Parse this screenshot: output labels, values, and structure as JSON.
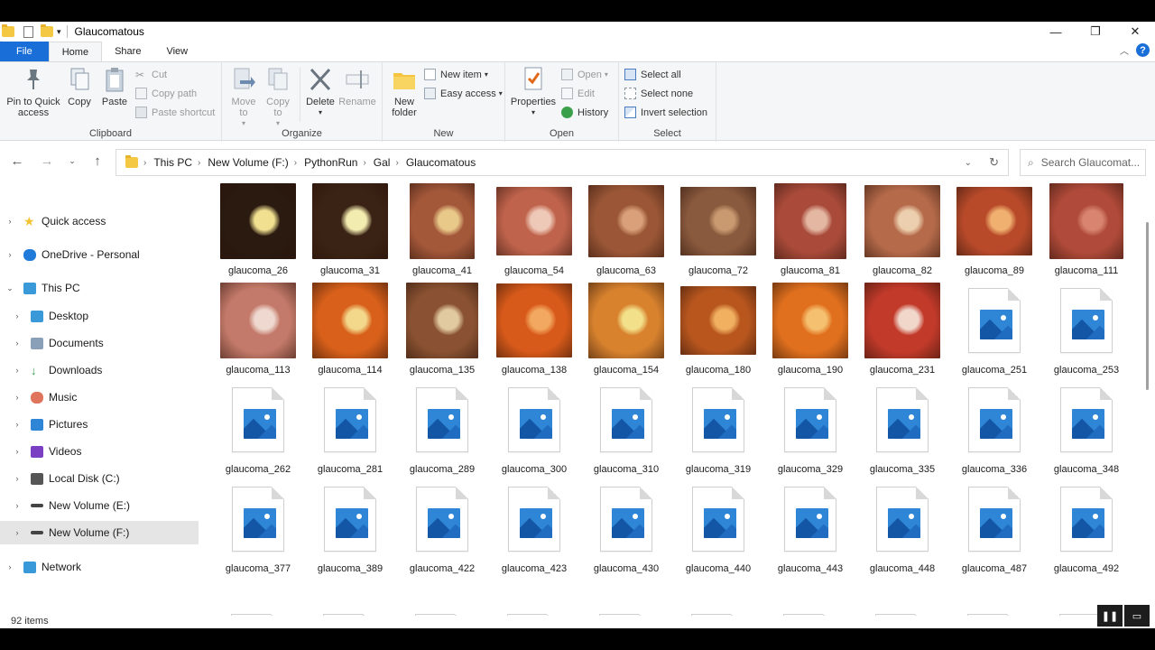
{
  "window": {
    "title": "Glaucomatous",
    "controls": [
      "—",
      "❐",
      "✕"
    ]
  },
  "ribbon_tabs": [
    "File",
    "Home",
    "Share",
    "View"
  ],
  "ribbon": {
    "clipboard": {
      "label": "Clipboard",
      "pin": "Pin to Quick access",
      "copy": "Copy",
      "paste": "Paste",
      "cut": "Cut",
      "copy_path": "Copy path",
      "paste_shortcut": "Paste shortcut"
    },
    "organize": {
      "label": "Organize",
      "move_to": "Move to",
      "copy_to": "Copy to",
      "delete": "Delete",
      "rename": "Rename"
    },
    "new": {
      "label": "New",
      "new_folder": "New folder",
      "new_item": "New item",
      "easy_access": "Easy access"
    },
    "open": {
      "label": "Open",
      "properties": "Properties",
      "open": "Open",
      "edit": "Edit",
      "history": "History"
    },
    "select": {
      "label": "Select",
      "select_all": "Select all",
      "select_none": "Select none",
      "invert": "Invert selection"
    }
  },
  "address": {
    "crumbs": [
      "This PC",
      "New Volume (F:)",
      "PythonRun",
      "Gal",
      "Glaucomatous"
    ],
    "search_placeholder": "Search Glaucomat..."
  },
  "nav_pane": [
    {
      "label": "Quick access",
      "icon": "star-icon",
      "color": "#f2c230"
    },
    {
      "label": "OneDrive - Personal",
      "icon": "cloud-icon",
      "color": "#1f7ad9"
    },
    {
      "label": "This PC",
      "icon": "computer-icon",
      "color": "#3a9ad9"
    },
    {
      "label": "Desktop",
      "icon": "desktop-icon",
      "color": "#3a9ad9"
    },
    {
      "label": "Documents",
      "icon": "documents-icon",
      "color": "#8aa0b8"
    },
    {
      "label": "Downloads",
      "icon": "download-icon",
      "color": "#2f9e44"
    },
    {
      "label": "Music",
      "icon": "music-icon",
      "color": "#e0735b"
    },
    {
      "label": "Pictures",
      "icon": "pictures-icon",
      "color": "#2f86d6"
    },
    {
      "label": "Videos",
      "icon": "videos-icon",
      "color": "#7b3fc4"
    },
    {
      "label": "Local Disk (C:)",
      "icon": "disk-icon",
      "color": "#555555"
    },
    {
      "label": "New Volume (E:)",
      "icon": "drive-icon",
      "color": "#444444"
    },
    {
      "label": "New Volume (F:)",
      "icon": "drive-icon",
      "color": "#444444"
    },
    {
      "label": "Network",
      "icon": "network-icon",
      "color": "#3a9ad9"
    }
  ],
  "files": [
    {
      "name": "glaucoma_26",
      "kind": "photo",
      "bg": "#2a1a10",
      "disc": "#f0e090"
    },
    {
      "name": "glaucoma_31",
      "kind": "photo",
      "bg": "#3a2214",
      "disc": "#f3ecb0"
    },
    {
      "name": "glaucoma_41",
      "kind": "photo",
      "bg": "#a4583a",
      "disc": "#e9c98a"
    },
    {
      "name": "glaucoma_54",
      "kind": "photo",
      "bg": "#c0634c",
      "disc": "#efc9b8"
    },
    {
      "name": "glaucoma_63",
      "kind": "photo",
      "bg": "#9a5636",
      "disc": "#d9a07a"
    },
    {
      "name": "glaucoma_72",
      "kind": "photo",
      "bg": "#8a5a3e",
      "disc": "#c99a70"
    },
    {
      "name": "glaucoma_81",
      "kind": "photo",
      "bg": "#a94a3a",
      "disc": "#e3b7a2"
    },
    {
      "name": "glaucoma_82",
      "kind": "photo",
      "bg": "#b56a4a",
      "disc": "#eccfae"
    },
    {
      "name": "glaucoma_89",
      "kind": "photo",
      "bg": "#b84a2a",
      "disc": "#f0b070"
    },
    {
      "name": "glaucoma_111",
      "kind": "photo",
      "bg": "#b04a3a",
      "disc": "#d88470"
    },
    {
      "name": "glaucoma_113",
      "kind": "photo",
      "bg": "#c47a6a",
      "disc": "#eed8cf"
    },
    {
      "name": "glaucoma_114",
      "kind": "photo",
      "bg": "#d8601a",
      "disc": "#f3d78a"
    },
    {
      "name": "glaucoma_135",
      "kind": "photo",
      "bg": "#8a5232",
      "disc": "#e2caa0"
    },
    {
      "name": "glaucoma_138",
      "kind": "photo",
      "bg": "#d85a1a",
      "disc": "#f2a860"
    },
    {
      "name": "glaucoma_154",
      "kind": "photo",
      "bg": "#d8822e",
      "disc": "#f3e08a"
    },
    {
      "name": "glaucoma_180",
      "kind": "photo",
      "bg": "#b8561e",
      "disc": "#f0b060"
    },
    {
      "name": "glaucoma_190",
      "kind": "photo",
      "bg": "#e0701e",
      "disc": "#f5c070"
    },
    {
      "name": "glaucoma_231",
      "kind": "photo",
      "bg": "#c23a2a",
      "disc": "#f1d6ca"
    },
    {
      "name": "glaucoma_251",
      "kind": "icon"
    },
    {
      "name": "glaucoma_253",
      "kind": "icon"
    },
    {
      "name": "glaucoma_262",
      "kind": "icon"
    },
    {
      "name": "glaucoma_281",
      "kind": "icon"
    },
    {
      "name": "glaucoma_289",
      "kind": "icon"
    },
    {
      "name": "glaucoma_300",
      "kind": "icon"
    },
    {
      "name": "glaucoma_310",
      "kind": "icon"
    },
    {
      "name": "glaucoma_319",
      "kind": "icon"
    },
    {
      "name": "glaucoma_329",
      "kind": "icon"
    },
    {
      "name": "glaucoma_335",
      "kind": "icon"
    },
    {
      "name": "glaucoma_336",
      "kind": "icon"
    },
    {
      "name": "glaucoma_348",
      "kind": "icon"
    },
    {
      "name": "glaucoma_377",
      "kind": "icon"
    },
    {
      "name": "glaucoma_389",
      "kind": "icon"
    },
    {
      "name": "glaucoma_422",
      "kind": "icon"
    },
    {
      "name": "glaucoma_423",
      "kind": "icon"
    },
    {
      "name": "glaucoma_430",
      "kind": "icon"
    },
    {
      "name": "glaucoma_440",
      "kind": "icon"
    },
    {
      "name": "glaucoma_443",
      "kind": "icon"
    },
    {
      "name": "glaucoma_448",
      "kind": "icon"
    },
    {
      "name": "glaucoma_487",
      "kind": "icon"
    },
    {
      "name": "glaucoma_492",
      "kind": "icon"
    }
  ],
  "status": {
    "item_count": "92 items"
  }
}
